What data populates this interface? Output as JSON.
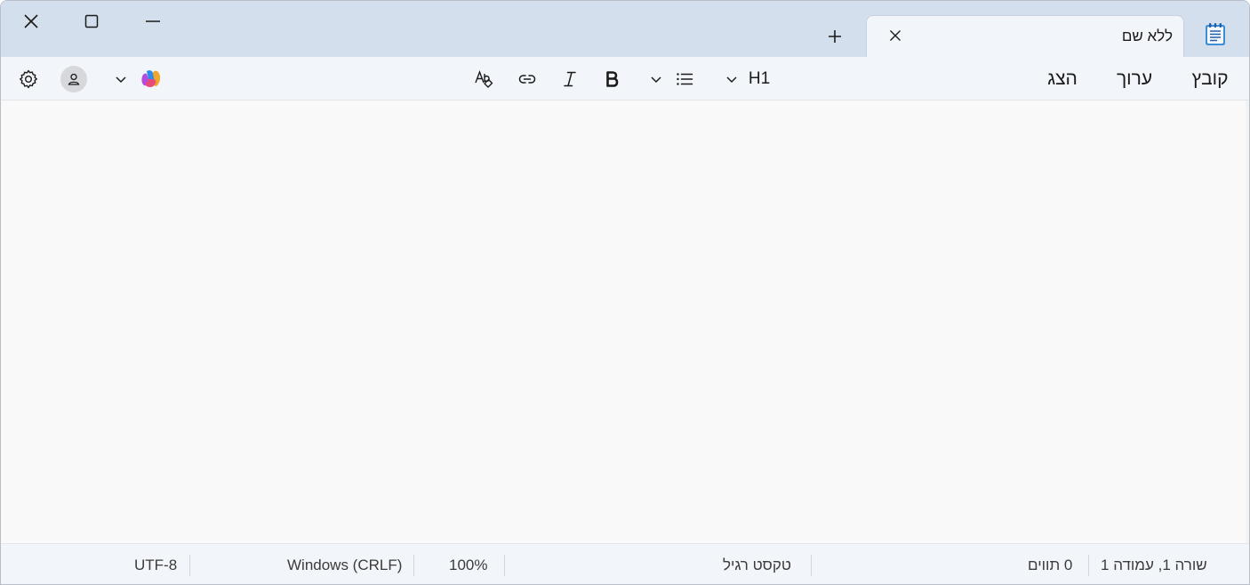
{
  "window": {
    "tab_title": "ללא שם",
    "caption": {
      "close": "close",
      "maximize": "maximize",
      "minimize": "minimize"
    }
  },
  "menu": {
    "file": "קובץ",
    "edit": "ערוך",
    "view": "הצג"
  },
  "toolbar": {
    "heading_label": "H1"
  },
  "status": {
    "position": "שורה 1, עמודה 1",
    "characters": "0 תווים",
    "format": "טקסט רגיל",
    "zoom": "100%",
    "line_ending": "Windows (CRLF)",
    "encoding": "UTF-8"
  },
  "icons": {
    "app": "notepad-icon",
    "settings": "gear-icon",
    "account": "account-icon",
    "copilot": "copilot-icon",
    "spellcheck": "spellcheck-icon",
    "link": "link-icon",
    "italic": "italic-icon",
    "bold": "bold-icon",
    "list": "list-icon",
    "dropdown": "chevron-down-icon"
  },
  "colors": {
    "titlebar": "#d3dfec",
    "toolbar": "#f2f5f9",
    "editor": "#f9f9f9",
    "accent": "#2b6fc6"
  }
}
